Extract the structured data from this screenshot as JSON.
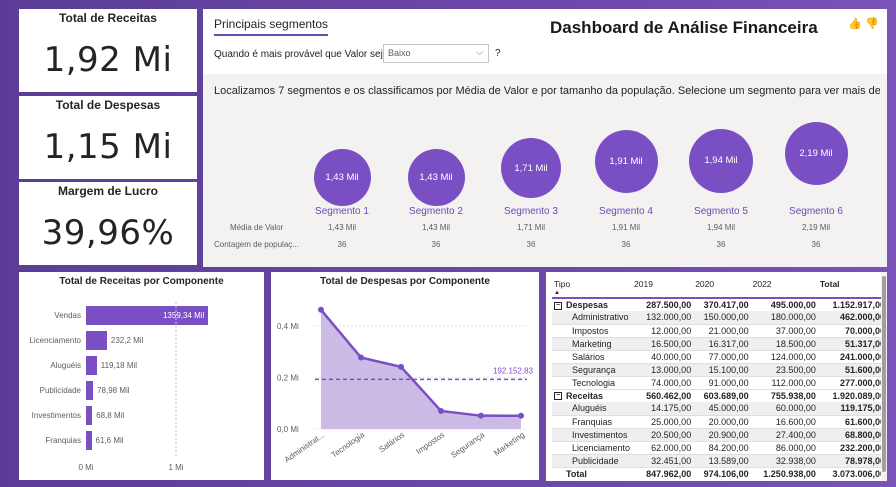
{
  "kpis": {
    "receitas": {
      "title": "Total de Receitas",
      "value": "1,92 Mi"
    },
    "despesas": {
      "title": "Total de Despesas",
      "value": "1,15 Mi"
    },
    "margem": {
      "title": "Margem de Lucro",
      "value": "39,96%"
    }
  },
  "segments": {
    "tab": "Principais segmentos",
    "question": "Quando é mais provável que Valor seja",
    "dropdown_value": "Baixo",
    "qmark": "?",
    "dashboard_title": "Dashboard de Análise Financeira",
    "thumbs_up_icon": "👍",
    "thumbs_down_icon": "👎",
    "description": "Localizamos 7 segmentos e os classificamos por Média de Valor e por tamanho da população. Selecione um segmento para ver mais de...",
    "row_label_media": "Média de Valor",
    "row_label_contagem": "Contagem de populaç...",
    "items": [
      {
        "bubble": "1,43 Mil",
        "name": "Segmento 1",
        "media": "1,43 Mil",
        "contagem": "36"
      },
      {
        "bubble": "1,43 Mil",
        "name": "Segmento 2",
        "media": "1,43 Mil",
        "contagem": "36"
      },
      {
        "bubble": "1,71 Mil",
        "name": "Segmento 3",
        "media": "1,71 Mil",
        "contagem": "36"
      },
      {
        "bubble": "1,91 Mil",
        "name": "Segmento 4",
        "media": "1,91 Mil",
        "contagem": "36"
      },
      {
        "bubble": "1,94 Mil",
        "name": "Segmento 5",
        "media": "1,94 Mil",
        "contagem": "36"
      },
      {
        "bubble": "2,19 Mil",
        "name": "Segmento 6",
        "media": "2,19 Mil",
        "contagem": "36"
      }
    ]
  },
  "chart_data": [
    {
      "type": "bar",
      "orientation": "horizontal",
      "title": "Total de Receitas por Componente",
      "categories": [
        "Vendas",
        "Licenciamento",
        "Aluguéis",
        "Publicidade",
        "Investimentos",
        "Franquias"
      ],
      "values": [
        1359.34,
        232.2,
        119.18,
        78.98,
        68.8,
        61.6
      ],
      "value_unit": "Mil",
      "data_labels": [
        "1359,34 Mil",
        "232,2 Mil",
        "119,18 Mil",
        "78,98 Mil",
        "68,8 Mil",
        "61,6 Mil"
      ],
      "x_ticks": [
        "0 Mi",
        "1 Mi"
      ],
      "xlim": [
        0,
        1.7
      ],
      "color": "#7b4fc4"
    },
    {
      "type": "area",
      "title": "Total de Despesas por Componente",
      "categories": [
        "Administrat...",
        "Tecnologia",
        "Salários",
        "Impostos",
        "Segurança",
        "Marketing"
      ],
      "values": [
        0.462,
        0.277,
        0.241,
        0.07,
        0.0516,
        0.05137
      ],
      "value_unit": "Mi",
      "y_ticks": [
        "0,0 Mi",
        "0,2 Mi",
        "0,4 Mi"
      ],
      "ylim": [
        0,
        0.5
      ],
      "average_line": {
        "value": 0.19215283,
        "label": "192.152,83"
      },
      "color": "#7b4fc4"
    }
  ],
  "matrix": {
    "headers": [
      "Tipo",
      "2019",
      "2020",
      "2022",
      "Total"
    ],
    "sort_icon": "▲",
    "expand_icon": "⊟",
    "groups": [
      {
        "name": "Despesas",
        "values": [
          "287.500,00",
          "370.417,00",
          "495.000,00",
          "1.152.917,00"
        ],
        "rows": [
          {
            "name": "Administrativo",
            "values": [
              "132.000,00",
              "150.000,00",
              "180.000,00",
              "462.000,00"
            ]
          },
          {
            "name": "Impostos",
            "values": [
              "12.000,00",
              "21.000,00",
              "37.000,00",
              "70.000,00"
            ]
          },
          {
            "name": "Marketing",
            "values": [
              "16.500,00",
              "16.317,00",
              "18.500,00",
              "51.317,00"
            ]
          },
          {
            "name": "Salários",
            "values": [
              "40.000,00",
              "77.000,00",
              "124.000,00",
              "241.000,00"
            ]
          },
          {
            "name": "Segurança",
            "values": [
              "13.000,00",
              "15.100,00",
              "23.500,00",
              "51.600,00"
            ]
          },
          {
            "name": "Tecnologia",
            "values": [
              "74.000,00",
              "91.000,00",
              "112.000,00",
              "277.000,00"
            ]
          }
        ]
      },
      {
        "name": "Receitas",
        "values": [
          "560.462,00",
          "603.689,00",
          "755.938,00",
          "1.920.089,00"
        ],
        "rows": [
          {
            "name": "Aluguéis",
            "values": [
              "14.175,00",
              "45.000,00",
              "60.000,00",
              "119.175,00"
            ]
          },
          {
            "name": "Franquias",
            "values": [
              "25.000,00",
              "20.000,00",
              "16.600,00",
              "61.600,00"
            ]
          },
          {
            "name": "Investimentos",
            "values": [
              "20.500,00",
              "20.900,00",
              "27.400,00",
              "68.800,00"
            ]
          },
          {
            "name": "Licenciamento",
            "values": [
              "62.000,00",
              "84.200,00",
              "86.000,00",
              "232.200,00"
            ]
          },
          {
            "name": "Publicidade",
            "values": [
              "32.451,00",
              "13.589,00",
              "32.938,00",
              "78.978,00"
            ]
          }
        ]
      }
    ],
    "total": {
      "name": "Total",
      "values": [
        "847.962,00",
        "974.106,00",
        "1.250.938,00",
        "3.073.006,00"
      ]
    }
  }
}
